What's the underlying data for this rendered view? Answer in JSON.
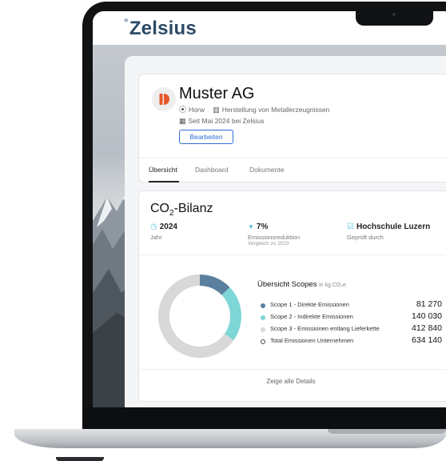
{
  "app": {
    "logo_mark": "°",
    "logo_text": "Zelsius"
  },
  "company": {
    "name": "Muster AG",
    "location": "Horw",
    "industry": "Herstellung von Metallerzeugnissen",
    "member_since": "Seit Mai 2024 bei Zelsius",
    "edit_label": "Bearbeiten",
    "logo_color": "#e8572a"
  },
  "tabs": [
    {
      "label": "Übersicht",
      "active": true
    },
    {
      "label": "Dashboard",
      "active": false
    },
    {
      "label": "Dokumente",
      "active": false
    }
  ],
  "co2": {
    "title_main": "CO",
    "title_sub": "2",
    "title_rest": "-Bilanz",
    "kpis": {
      "year": {
        "value": "2024",
        "label": "Jahr"
      },
      "reduction": {
        "value": "7%",
        "label": "Emissionsreduktion",
        "sub": "Vergleich zu 2023"
      },
      "verifier": {
        "value": "Hochschule Luzern",
        "label": "Geprüft durch"
      }
    },
    "scopes_title": "Übersicht Scopes",
    "scopes_unit": "in kg CO₂e",
    "scopes": [
      {
        "label": "Scope 1 - Direkte Emissionen",
        "value": "81 270",
        "color": "#5b7f9e"
      },
      {
        "label": "Scope 2 - Indirekte Emissionen",
        "value": "140 030",
        "color": "#7fd6d6"
      },
      {
        "label": "Scope 3 - Emissionen entlang Lieferkette",
        "value": "412 840",
        "color": "#d8d8d8"
      },
      {
        "label": "Total Emissionen Unternehmen",
        "value": "634 140",
        "color": "#ffffff"
      }
    ],
    "details_label": "Zeige alle Details"
  },
  "chart_data": {
    "type": "pie",
    "categories": [
      "Scope 1 - Direkte Emissionen",
      "Scope 2 - Indirekte Emissionen",
      "Scope 3 - Emissionen entlang Lieferkette"
    ],
    "values": [
      81270,
      140030,
      412840
    ],
    "colors": [
      "#5b7f9e",
      "#7fd6d6",
      "#d8d8d8"
    ],
    "donut": true
  }
}
